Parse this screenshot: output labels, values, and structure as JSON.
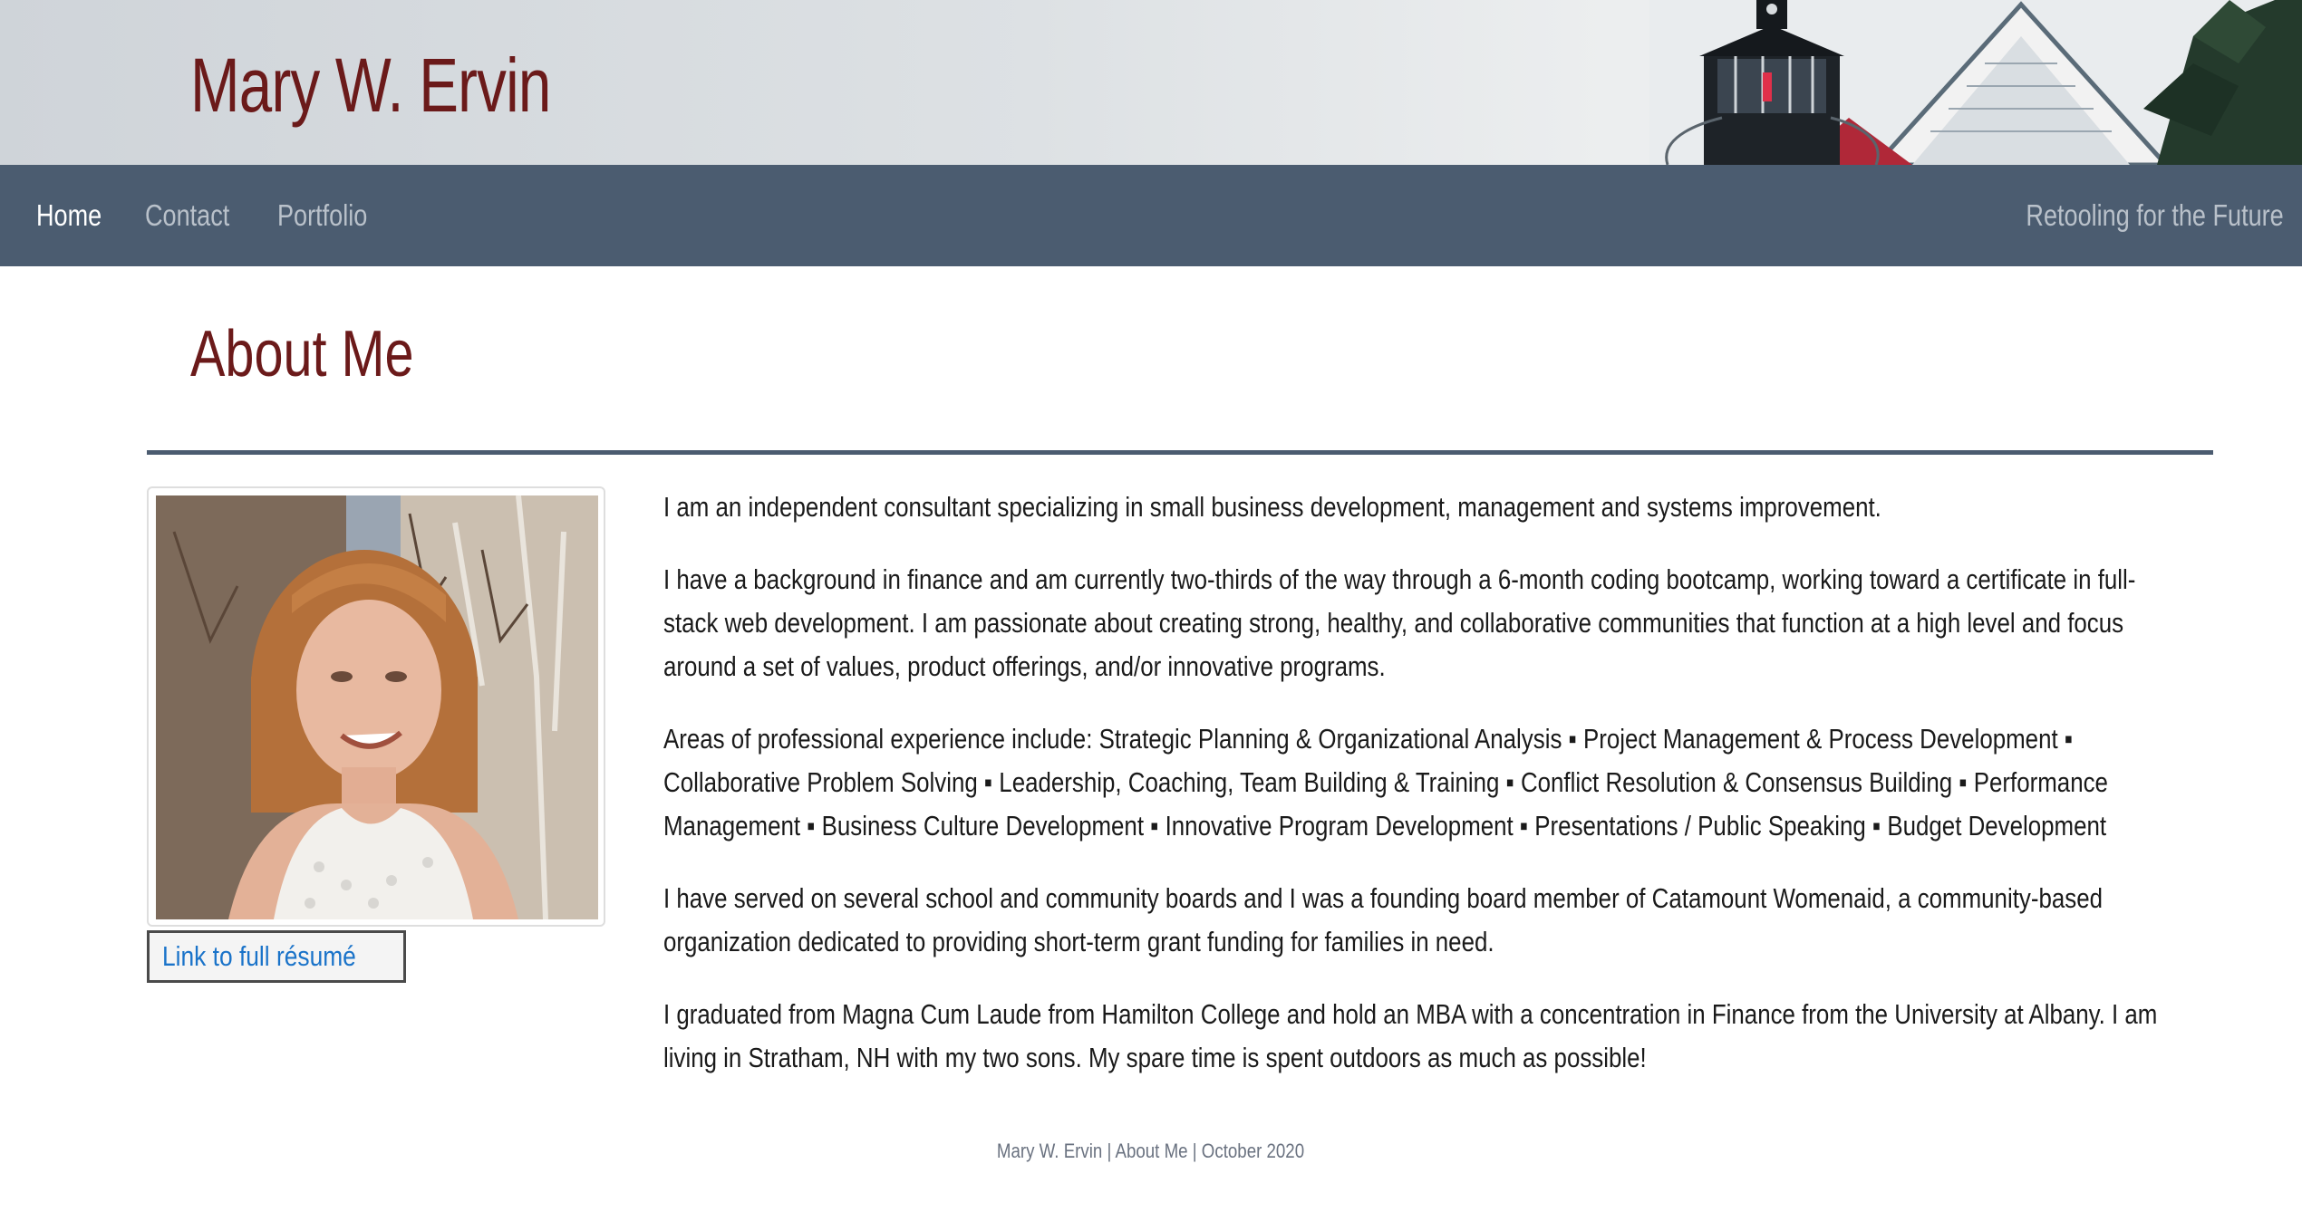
{
  "header": {
    "site_title": "Mary W. Ervin"
  },
  "nav": {
    "items": [
      {
        "label": "Home",
        "active": true
      },
      {
        "label": "Contact",
        "active": false
      },
      {
        "label": "Portfolio",
        "active": false
      }
    ],
    "tagline": "Retooling for the Future"
  },
  "main": {
    "heading": "About Me",
    "resume_link": "Link to full résumé",
    "paragraphs": [
      "I am an independent consultant specializing in small business development, management and systems improvement.",
      "I have a background in finance and am currently two-thirds of the way through a 6-month coding bootcamp, working toward a certificate in full-stack web development. I am passionate about creating strong, healthy, and collaborative communities that function at a high level and focus around a set of values, product offerings, and/or innovative programs.",
      "Areas of professional experience include: Strategic Planning & Organizational Analysis ▪ Project Management & Process Development ▪ Collaborative Problem Solving ▪ Leadership, Coaching, Team Building & Training ▪ Conflict Resolution & Consensus Building ▪ Performance Management ▪ Business Culture Development ▪ Innovative Program Development ▪ Presentations / Public Speaking ▪ Budget Development",
      "I have served on several school and community boards and I was a founding board member of Catamount Womenaid, a community-based organization dedicated to providing short-term grant funding for families in need.",
      "I graduated from Magna Cum Laude from Hamilton College and hold an MBA with a concentration in Finance from the University at Albany. I am living in Stratham, NH with my two sons. My spare time is spent outdoors as much as possible!"
    ]
  },
  "footer": {
    "text": "Mary W. Ervin | About Me | October 2020"
  },
  "colors": {
    "accent": "#6b1a1a",
    "nav_background": "#4b5c70",
    "link": "#1a73c9"
  }
}
